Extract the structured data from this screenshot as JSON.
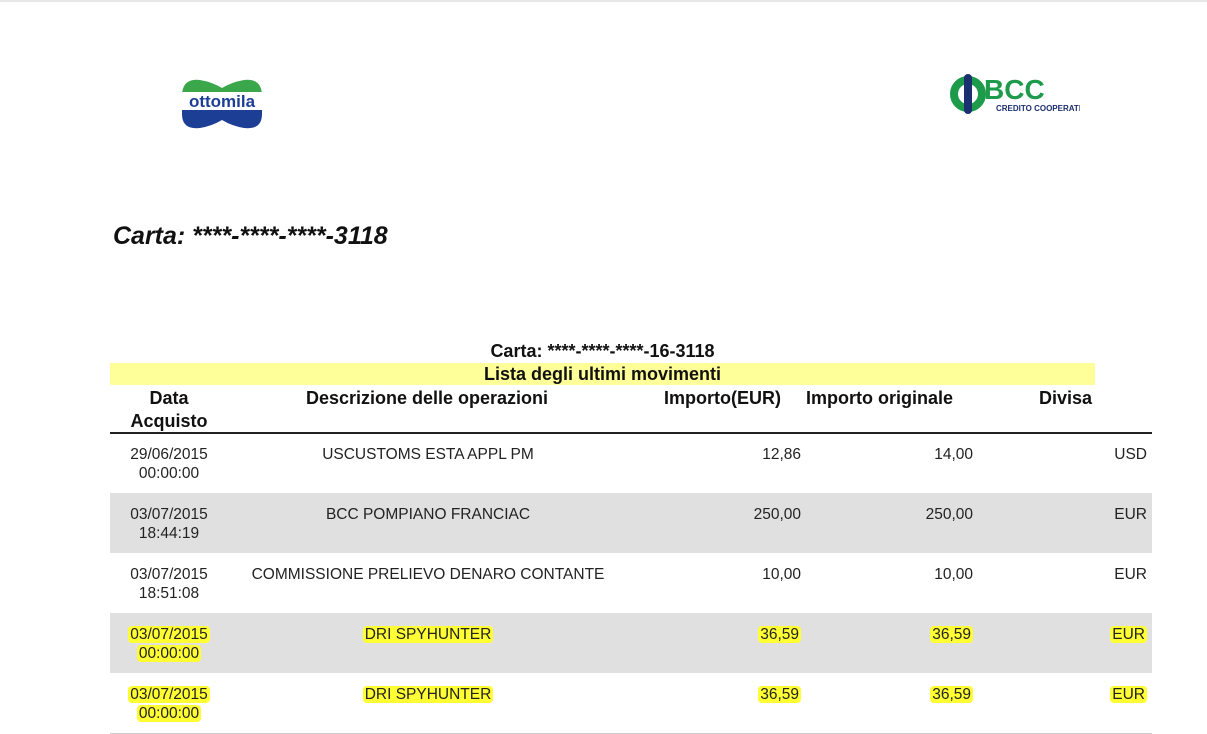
{
  "logos": {
    "left": "ottomila",
    "right_main": "BCC",
    "right_sub": "CREDITO COOPERATIVO"
  },
  "card_title": "Carta: ****-****-****-3118",
  "card_subtitle": "Carta: ****-****-****-16-3118",
  "list_title": "Lista degli ultimi movimenti",
  "headers": {
    "date1": "Data",
    "date2": "Acquisto",
    "desc": "Descrizione delle operazioni",
    "imp": "Importo(EUR)",
    "orig": "Importo originale",
    "div": "Divisa"
  },
  "rows": [
    {
      "date": "29/06/2015",
      "time": "00:00:00",
      "desc": "USCUSTOMS ESTA APPL PM",
      "imp": "12,86",
      "orig": "14,00",
      "div": "USD"
    },
    {
      "date": "03/07/2015",
      "time": "18:44:19",
      "desc": "BCC POMPIANO FRANCIAC",
      "imp": "250,00",
      "orig": "250,00",
      "div": "EUR"
    },
    {
      "date": "03/07/2015",
      "time": "18:51:08",
      "desc": "COMMISSIONE PRELIEVO DENARO CONTANTE",
      "imp": "10,00",
      "orig": "10,00",
      "div": "EUR"
    },
    {
      "date": "03/07/2015",
      "time": "00:00:00",
      "desc": "DRI SPYHUNTER",
      "imp": "36,59",
      "orig": "36,59",
      "div": "EUR"
    },
    {
      "date": "03/07/2015",
      "time": "00:00:00",
      "desc": "DRI SPYHUNTER",
      "imp": "36,59",
      "orig": "36,59",
      "div": "EUR"
    }
  ]
}
